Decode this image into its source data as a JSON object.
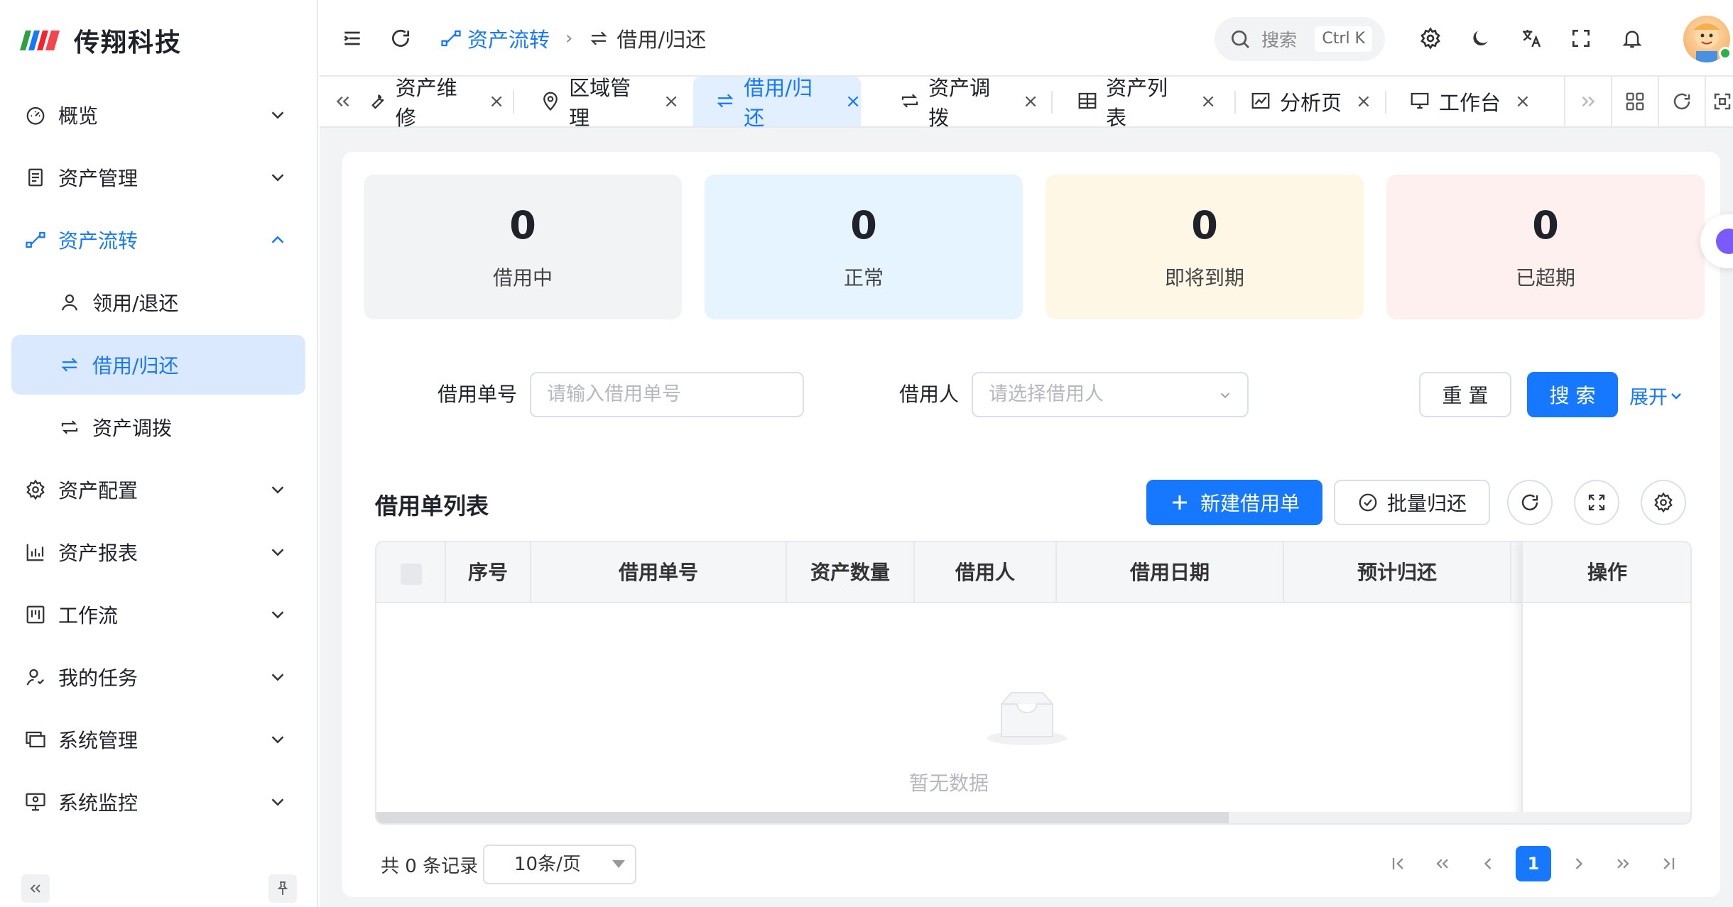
{
  "app": {
    "name": "传翔科技"
  },
  "sidebar": {
    "items": [
      {
        "label": "概览",
        "icon": "dashboard-icon"
      },
      {
        "label": "资产管理",
        "icon": "document-icon"
      },
      {
        "label": "资产流转",
        "icon": "flow-icon",
        "expanded": true
      },
      {
        "label": "领用/退还",
        "icon": "user-icon",
        "sub": true
      },
      {
        "label": "借用/归还",
        "icon": "swap-icon",
        "sub": true,
        "active": true
      },
      {
        "label": "资产调拨",
        "icon": "transfer-icon",
        "sub": true
      },
      {
        "label": "资产配置",
        "icon": "gear-icon"
      },
      {
        "label": "资产报表",
        "icon": "bar-chart-icon"
      },
      {
        "label": "工作流",
        "icon": "workflow-icon"
      },
      {
        "label": "我的任务",
        "icon": "user-task-icon"
      },
      {
        "label": "系统管理",
        "icon": "monitor-icon"
      },
      {
        "label": "系统监控",
        "icon": "monitor-settings-icon"
      }
    ]
  },
  "header": {
    "breadcrumb": [
      "资产流转",
      "借用/归还"
    ],
    "search_placeholder": "搜索",
    "search_shortcut": "Ctrl K"
  },
  "tabs": [
    {
      "label": "资产维修",
      "icon": "wrench-icon",
      "close": "×"
    },
    {
      "label": "区域管理",
      "icon": "location-icon",
      "close": "×"
    },
    {
      "label": "借用/归还",
      "icon": "swap-icon",
      "close": "×",
      "active": true
    },
    {
      "label": "资产调拨",
      "icon": "transfer-icon",
      "close": "×"
    },
    {
      "label": "资产列表",
      "icon": "table-icon",
      "close": "×"
    },
    {
      "label": "分析页",
      "icon": "line-chart-icon",
      "close": "×"
    },
    {
      "label": "工作台",
      "icon": "desktop-icon",
      "close": "×"
    }
  ],
  "stats": [
    {
      "value": "0",
      "label": "借用中",
      "bg": "#f2f3f5"
    },
    {
      "value": "0",
      "label": "正常",
      "bg": "#e6f4ff"
    },
    {
      "value": "0",
      "label": "即将到期",
      "bg": "#fff7e6"
    },
    {
      "value": "0",
      "label": "已超期",
      "bg": "#fff0f0"
    }
  ],
  "filters": {
    "order_no_label": "借用单号",
    "order_no_placeholder": "请输入借用单号",
    "borrower_label": "借用人",
    "borrower_placeholder": "请选择借用人",
    "reset": "重 置",
    "search": "搜 索",
    "expand": "展开"
  },
  "list": {
    "title": "借用单列表",
    "new_button": "新建借用单",
    "batch_return": "批量归还",
    "columns": [
      "序号",
      "借用单号",
      "资产数量",
      "借用人",
      "借用日期",
      "预计归还",
      "操作"
    ],
    "empty_text": "暂无数据"
  },
  "pagination": {
    "total_text": "共 0 条记录",
    "page_size": "10条/页",
    "current_page": "1"
  },
  "colors": {
    "primary": "#1677ff",
    "active_bg": "#dbe9ff"
  }
}
